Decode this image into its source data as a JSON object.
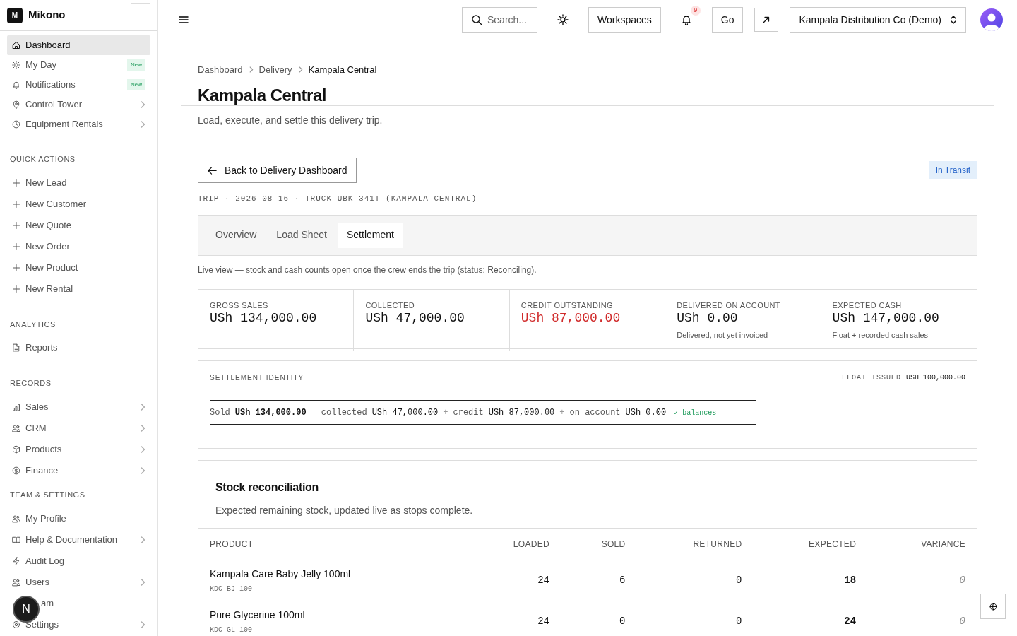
{
  "brand": {
    "logo_letter": "M",
    "name": "Mikono"
  },
  "sidebar": {
    "groups": [
      {
        "items": [
          {
            "label": "Dashboard",
            "selected": true,
            "chevron": false
          },
          {
            "label": "My Day",
            "selected": false,
            "badge": "New",
            "chevron": false
          },
          {
            "label": "Notifications",
            "selected": false,
            "badge": "New",
            "chevron": false
          },
          {
            "label": "Control Tower",
            "selected": false,
            "chevron": true
          },
          {
            "label": "Equipment Rentals",
            "selected": false,
            "chevron": true
          }
        ]
      },
      {
        "title": "QUICK ACTIONS",
        "items": [
          {
            "label": "New Lead",
            "selected": false,
            "chevron": false
          },
          {
            "label": "New Customer",
            "selected": false,
            "chevron": false
          },
          {
            "label": "New Quote",
            "selected": false,
            "chevron": false
          },
          {
            "label": "New Order",
            "selected": false,
            "chevron": false
          },
          {
            "label": "New Product",
            "selected": false,
            "chevron": false
          },
          {
            "label": "New Rental",
            "selected": false,
            "chevron": false
          }
        ]
      },
      {
        "title": "ANALYTICS",
        "items": [
          {
            "label": "Reports",
            "selected": false,
            "chevron": false
          }
        ]
      },
      {
        "title": "RECORDS",
        "items": [
          {
            "label": "Sales",
            "selected": false,
            "chevron": true
          },
          {
            "label": "CRM",
            "selected": false,
            "chevron": true
          },
          {
            "label": "Products",
            "selected": false,
            "chevron": true
          },
          {
            "label": "Finance",
            "selected": false,
            "chevron": true
          }
        ]
      }
    ],
    "footer_group": {
      "title": "TEAM & SETTINGS",
      "items": [
        {
          "label": "My Profile",
          "selected": false,
          "chevron": false
        },
        {
          "label": "Help & Documentation",
          "selected": false,
          "chevron": true
        },
        {
          "label": "Audit Log",
          "selected": false,
          "chevron": false
        },
        {
          "label": "Users",
          "selected": false,
          "chevron": true
        },
        {
          "label": "am",
          "selected": false,
          "chevron": false,
          "covered": true
        },
        {
          "label": "Settings",
          "selected": false,
          "chevron": true
        }
      ]
    },
    "overlay_badge": "N"
  },
  "topbar": {
    "search": {
      "placeholder": "Search..."
    },
    "workspaces": "Workspaces",
    "notification_count": "9",
    "go": "Go",
    "organization": "Kampala Distribution Co (Demo)"
  },
  "breadcrumbs": [
    {
      "label": "Dashboard",
      "current": false
    },
    {
      "label": "Delivery",
      "current": false
    },
    {
      "label": "Kampala Central",
      "current": true
    }
  ],
  "page": {
    "title": "Kampala Central",
    "subtitle": "Load, execute, and settle this delivery trip.",
    "back_button": "Back to Delivery Dashboard",
    "status": "In Transit",
    "meta": "TRIP · 2026-08-16 · TRUCK UBK 341T (KAMPALA CENTRAL)"
  },
  "tabs": [
    {
      "label": "Overview",
      "selected": false
    },
    {
      "label": "Load Sheet",
      "selected": false
    },
    {
      "label": "Settlement",
      "selected": true
    }
  ],
  "note": "Live view — stock and cash counts open once the crew ends the trip (status: Reconciling).",
  "metrics": [
    {
      "label": "GROSS SALES",
      "value": "USh 134,000.00",
      "alert": false
    },
    {
      "label": "COLLECTED",
      "value": "USh 47,000.00",
      "alert": false
    },
    {
      "label": "CREDIT OUTSTANDING",
      "value": "USh 87,000.00",
      "alert": true
    },
    {
      "label": "DELIVERED ON ACCOUNT",
      "value": "USh 0.00",
      "alert": false,
      "note": "Delivered, not yet invoiced"
    },
    {
      "label": "EXPECTED CASH",
      "value": "USh 147,000.00",
      "alert": false,
      "note": "Float + recorded cash sales"
    }
  ],
  "identity": {
    "title": "SETTLEMENT IDENTITY",
    "float_label": "FLOAT ISSUED",
    "float_value": "USH 100,000.00",
    "parts": [
      {
        "kind": "word",
        "text": "Sold"
      },
      {
        "kind": "amount",
        "text": "USh 134,000.00",
        "strong": true
      },
      {
        "kind": "op",
        "text": "="
      },
      {
        "kind": "word",
        "text": "collected"
      },
      {
        "kind": "amount",
        "text": "USh 47,000.00",
        "strong": false
      },
      {
        "kind": "op",
        "text": "+"
      },
      {
        "kind": "word",
        "text": "credit"
      },
      {
        "kind": "amount",
        "text": "USh 87,000.00",
        "strong": false
      },
      {
        "kind": "op",
        "text": "+"
      },
      {
        "kind": "word",
        "text": "on account"
      },
      {
        "kind": "amount",
        "text": "USh 0.00",
        "strong": false
      },
      {
        "kind": "ok",
        "text": "✓ balances"
      }
    ]
  },
  "stock": {
    "title": "Stock reconciliation",
    "description": "Expected remaining stock, updated live as stops complete.",
    "columns": [
      "PRODUCT",
      "LOADED",
      "SOLD",
      "RETURNED",
      "EXPECTED",
      "VARIANCE"
    ],
    "rows": [
      {
        "product": "Kampala Care Baby Jelly 100ml",
        "sku": "KDC-BJ-100",
        "loaded": "24",
        "sold": "6",
        "returned": "0",
        "expected": "18",
        "variance": "0"
      },
      {
        "product": "Pure Glycerine 100ml",
        "sku": "KDC-GL-100",
        "loaded": "24",
        "sold": "0",
        "returned": "0",
        "expected": "24",
        "variance": "0"
      }
    ]
  }
}
